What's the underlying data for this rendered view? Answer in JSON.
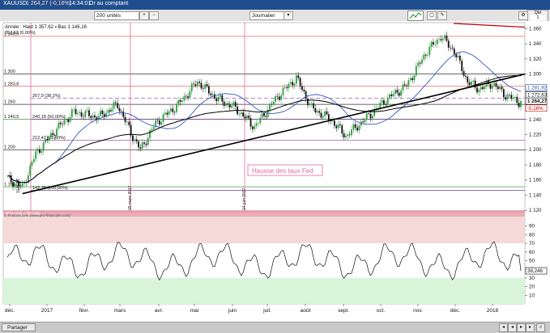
{
  "topbar": {
    "symbol": "XAUUSD",
    "quote": "1 264,27 (-0,16%)",
    "time": "14:34:01",
    "mode": "Or au comptant"
  },
  "toolbar": {
    "units": "200 unités",
    "journal": "Journalier",
    "qty_label": "Qté",
    "qty_value": "1"
  },
  "legend": {
    "line1": "Année : Haut 1 357,62 ▪ Bas 1 146,16",
    "line2": "357,62 (0,00%)"
  },
  "annotations": {
    "fed": "Hausse des taux Fed",
    "date1": "15 mars 2017",
    "date2": "14 juin 2017",
    "copyright": "© Finance.com (www.pro-financials.com)",
    "low": "1146,16"
  },
  "price_axis": [
    "1 360",
    "1 340",
    "1 320",
    "1 300",
    "1 280",
    "1 260",
    "1 240",
    "1 220",
    "1 200",
    "1 180",
    "1 160",
    "1 140",
    "1 120"
  ],
  "left_levels": [
    {
      "label": "1 349,9",
      "price": 1349.9,
      "color": "#d44a4a"
    },
    {
      "label": "1 300",
      "price": 1300,
      "color": "#333333"
    },
    {
      "label": "1 283,8",
      "price": 1283.8,
      "color": "#d44a4a"
    },
    {
      "label": "1 260",
      "price": 1260,
      "color": "#333333"
    },
    {
      "label": "1 240,5",
      "price": 1240.5,
      "color": "#3aa03a"
    },
    {
      "label": "1 200",
      "price": 1200,
      "color": "#333333"
    },
    {
      "label": "1 151,01",
      "price": 1151.01,
      "color": "#3aa03a"
    }
  ],
  "fibo": [
    {
      "label": "267,9 (38,2%)",
      "price": 1267.9
    },
    {
      "label": "240,18 (50,00%)",
      "price": 1240.18
    },
    {
      "label": "212,47 (61,80%)",
      "price": 1212.47
    },
    {
      "label": "142,75 (100,00%)",
      "price": 1146.16
    }
  ],
  "price_tags": [
    {
      "label": "1 281,92",
      "price": 1281.92,
      "color": "#2b4fa8"
    },
    {
      "label": "1 272,63",
      "price": 1272.63,
      "color": "#111111"
    },
    {
      "label": "1 264,27",
      "price": 1264.27,
      "color": "#111111",
      "bold": true
    },
    {
      "label": "-0,16%",
      "price": 1255,
      "color": "#c00000"
    }
  ],
  "rsi": {
    "header": "RSI (14) ▪ 38,246",
    "axis": [
      "90",
      "80",
      "70",
      "60",
      "50",
      "40",
      "30",
      "20",
      "10"
    ],
    "value_tag": "38,246"
  },
  "time_axis": [
    "déc.",
    "2017",
    "févr.",
    "mars",
    "avr.",
    "mai",
    "juin",
    "juil.",
    "août",
    "sept.",
    "oct.",
    "nov.",
    "déc.",
    "2018"
  ],
  "bottombar": {
    "share": "Partager"
  },
  "colors": {
    "bull": "#2e9e3e",
    "bear": "#111111",
    "ma_blue": "#3356c0",
    "ma_black": "#000000",
    "fibo": "#8a3f9e",
    "fed_pink": "#e06aa0",
    "rsi_over": "#f5d9d9",
    "rsi_under": "#d9f5d9"
  }
}
